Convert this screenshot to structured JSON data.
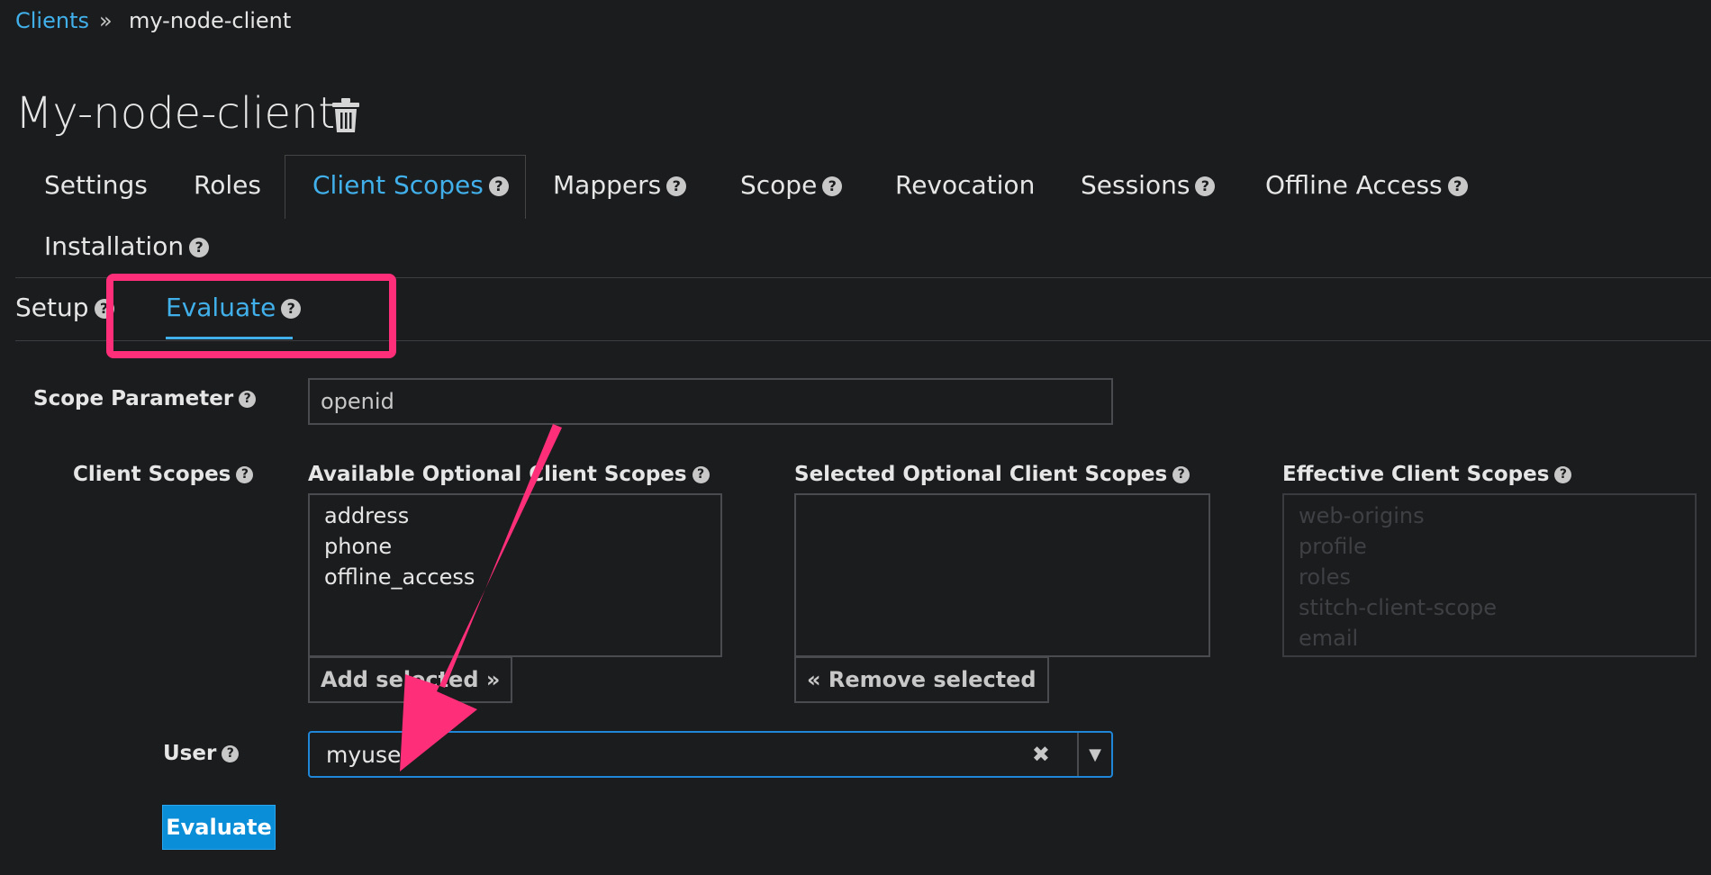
{
  "breadcrumb": {
    "link": "Clients",
    "separator": "»",
    "current": "my-node-client"
  },
  "page": {
    "title": "My-node-client"
  },
  "tabs": [
    {
      "label": "Settings",
      "help": false
    },
    {
      "label": "Roles",
      "help": false
    },
    {
      "label": "Client Scopes",
      "help": true,
      "active": true
    },
    {
      "label": "Mappers",
      "help": true
    },
    {
      "label": "Scope",
      "help": true
    },
    {
      "label": "Revocation",
      "help": false
    },
    {
      "label": "Sessions",
      "help": true
    },
    {
      "label": "Offline Access",
      "help": true
    },
    {
      "label": "Installation",
      "help": true
    }
  ],
  "subtabs": {
    "setup": "Setup",
    "evaluate": "Evaluate"
  },
  "help_glyph": "?",
  "form": {
    "scope_parameter": {
      "label": "Scope Parameter",
      "value": "openid"
    },
    "client_scopes": {
      "label": "Client Scopes",
      "available": {
        "title": "Available Optional Client Scopes",
        "items": [
          "address",
          "phone",
          "offline_access"
        ]
      },
      "selected": {
        "title": "Selected Optional Client Scopes",
        "items": []
      },
      "effective": {
        "title": "Effective Client Scopes",
        "items": [
          "web-origins",
          "profile",
          "roles",
          "stitch-client-scope",
          "email"
        ]
      },
      "add_button": "Add selected »",
      "remove_button": "« Remove selected"
    },
    "user": {
      "label": "User",
      "value": "myuser",
      "clear": "✖",
      "dropdown": "▼"
    },
    "evaluate_button": "Evaluate"
  },
  "colors": {
    "accent": "#41b0ea",
    "highlight": "#ff2e78",
    "primary": "#0b8ed8"
  },
  "icons": {
    "trash": "trash-icon",
    "help": "help-icon"
  }
}
